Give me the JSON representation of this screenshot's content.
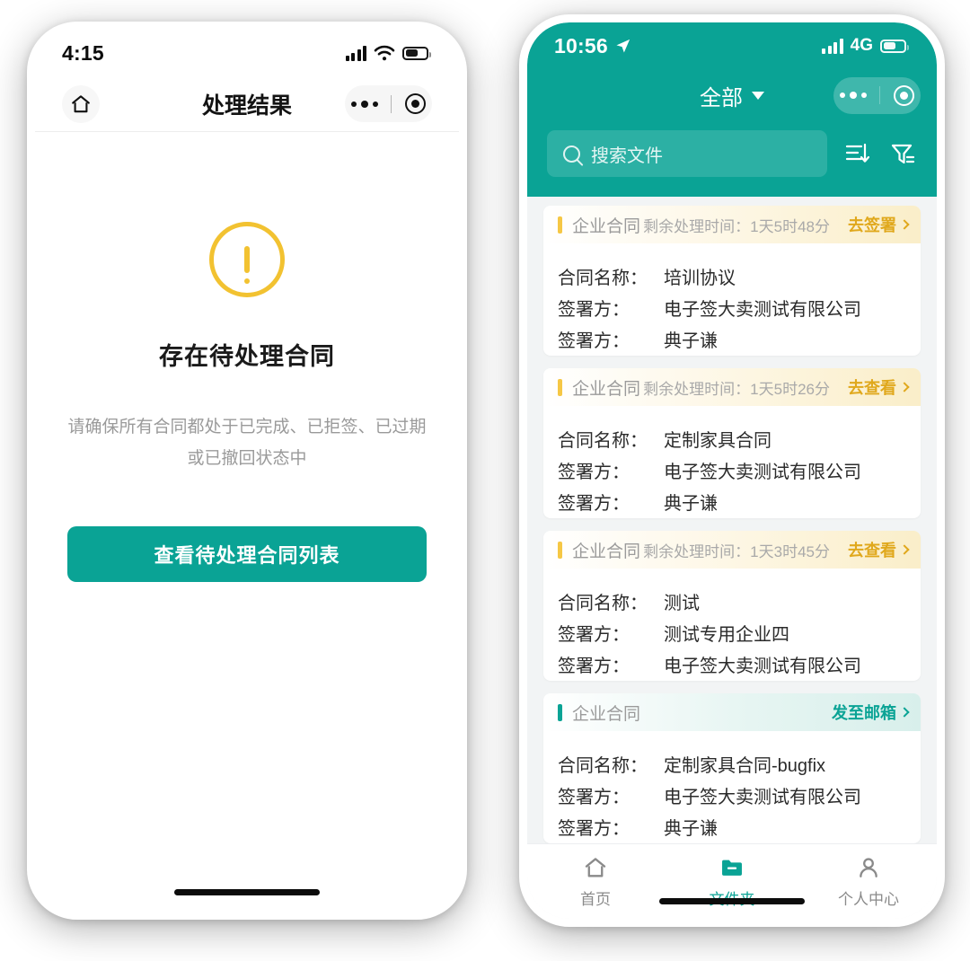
{
  "left_phone": {
    "status": {
      "time": "4:15",
      "signal_icon": "signal-bars-icon",
      "wifi_icon": "wifi-icon",
      "battery_icon": "battery-icon"
    },
    "navbar": {
      "home_icon": "home-icon",
      "title": "处理结果",
      "capsule": {
        "more_icon": "more-dots-icon",
        "target_icon": "target-circle-icon"
      }
    },
    "result": {
      "warning_icon": "warning-exclamation-icon",
      "warning_color": "#F2C231",
      "title": "存在待处理合同",
      "description": "请确保所有合同都处于已完成、已拒签、已过期或已撤回状态中",
      "button_label": "查看待处理合同列表",
      "button_color": "#0AA395"
    }
  },
  "right_phone": {
    "status": {
      "time": "10:56",
      "location_icon": "location-arrow-icon",
      "signal_icon": "signal-bars-icon",
      "network": "4G",
      "battery_icon": "battery-icon"
    },
    "navbar": {
      "title": "全部",
      "dropdown_icon": "chevron-down-icon",
      "capsule": {
        "more_icon": "more-dots-icon",
        "target_icon": "target-circle-icon"
      }
    },
    "search": {
      "placeholder": "搜索文件",
      "value": "",
      "icon": "search-icon"
    },
    "toolbar": {
      "sort_icon": "sort-descending-icon",
      "filter_icon": "filter-funnel-icon"
    },
    "theme": {
      "header_color": "#0AA395",
      "accent_amber": "#F6C745",
      "accent_teal": "#0AA395"
    },
    "cards": [
      {
        "kind": "企业合同",
        "time_label": "剩余处理时间：",
        "time_value": "1天5时48分",
        "action": "去签署",
        "action_icon": "chevron-right-icon",
        "style": "amber",
        "rows": [
          {
            "label": "合同名称：",
            "value": "培训协议"
          },
          {
            "label": "签署方：",
            "value": "电子签大卖测试有限公司"
          },
          {
            "label": "签署方：",
            "value": "典子谦"
          }
        ]
      },
      {
        "kind": "企业合同",
        "time_label": "剩余处理时间：",
        "time_value": "1天5时26分",
        "action": "去查看",
        "action_icon": "chevron-right-icon",
        "style": "amber",
        "rows": [
          {
            "label": "合同名称：",
            "value": "定制家具合同"
          },
          {
            "label": "签署方：",
            "value": "电子签大卖测试有限公司"
          },
          {
            "label": "签署方：",
            "value": "典子谦"
          }
        ]
      },
      {
        "kind": "企业合同",
        "time_label": "剩余处理时间：",
        "time_value": "1天3时45分",
        "action": "去查看",
        "action_icon": "chevron-right-icon",
        "style": "amber",
        "rows": [
          {
            "label": "合同名称：",
            "value": "测试"
          },
          {
            "label": "签署方：",
            "value": "测试专用企业四"
          },
          {
            "label": "签署方：",
            "value": "电子签大卖测试有限公司"
          }
        ]
      },
      {
        "kind": "企业合同",
        "time_label": "",
        "time_value": "",
        "action": "发至邮箱",
        "action_icon": "chevron-right-icon",
        "style": "teal",
        "rows": [
          {
            "label": "合同名称：",
            "value": "定制家具合同-bugfix"
          },
          {
            "label": "签署方：",
            "value": "电子签大卖测试有限公司"
          },
          {
            "label": "签署方：",
            "value": "典子谦"
          }
        ]
      }
    ],
    "tabbar": [
      {
        "label": "首页",
        "icon": "home-icon",
        "active": false
      },
      {
        "label": "文件夹",
        "icon": "folder-icon",
        "active": true
      },
      {
        "label": "个人中心",
        "icon": "person-icon",
        "active": false
      }
    ]
  }
}
